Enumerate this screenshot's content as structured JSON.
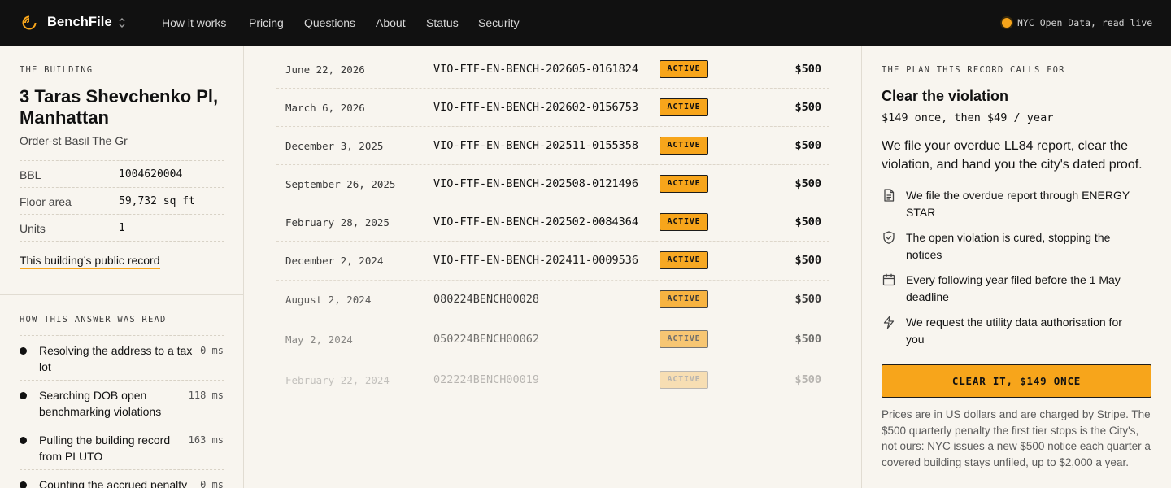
{
  "header": {
    "brand": "BenchFile",
    "nav": [
      "How it works",
      "Pricing",
      "Questions",
      "About",
      "Status",
      "Security"
    ],
    "status_text": "NYC Open Data, read live",
    "accent_color": "#f7a51b"
  },
  "building": {
    "eyebrow": "THE BUILDING",
    "title_line1": "3 Taras Shevchenko Pl,",
    "title_line2": "Manhattan",
    "subtitle": "Order-st Basil The Gr",
    "facts": [
      {
        "key": "BBL",
        "value": "1004620004"
      },
      {
        "key": "Floor area",
        "value": "59,732 sq ft"
      },
      {
        "key": "Units",
        "value": "1"
      }
    ],
    "record_link": "This building’s public record"
  },
  "reading": {
    "eyebrow": "HOW THIS ANSWER WAS READ",
    "steps": [
      {
        "label": "Resolving the address to a tax lot",
        "ms": "0 ms"
      },
      {
        "label": "Searching DOB open benchmarking violations",
        "ms": "118 ms"
      },
      {
        "label": "Pulling the building record from PLUTO",
        "ms": "163 ms"
      },
      {
        "label": "Counting the accrued penalty",
        "ms": "0 ms"
      }
    ]
  },
  "violations": [
    {
      "date": "June 22, 2026",
      "id": "VIO-FTF-EN-BENCH-202605-0161824",
      "status": "ACTIVE",
      "amount": "$500"
    },
    {
      "date": "March 6, 2026",
      "id": "VIO-FTF-EN-BENCH-202602-0156753",
      "status": "ACTIVE",
      "amount": "$500"
    },
    {
      "date": "December 3, 2025",
      "id": "VIO-FTF-EN-BENCH-202511-0155358",
      "status": "ACTIVE",
      "amount": "$500"
    },
    {
      "date": "September 26, 2025",
      "id": "VIO-FTF-EN-BENCH-202508-0121496",
      "status": "ACTIVE",
      "amount": "$500"
    },
    {
      "date": "February 28, 2025",
      "id": "VIO-FTF-EN-BENCH-202502-0084364",
      "status": "ACTIVE",
      "amount": "$500"
    },
    {
      "date": "December 2, 2024",
      "id": "VIO-FTF-EN-BENCH-202411-0009536",
      "status": "ACTIVE",
      "amount": "$500"
    },
    {
      "date": "August 2, 2024",
      "id": "080224BENCH00028",
      "status": "ACTIVE",
      "amount": "$500"
    },
    {
      "date": "May 2, 2024",
      "id": "050224BENCH00062",
      "status": "ACTIVE",
      "amount": "$500"
    },
    {
      "date": "February 22, 2024",
      "id": "022224BENCH00019",
      "status": "ACTIVE",
      "amount": "$500"
    }
  ],
  "plan": {
    "eyebrow": "THE PLAN THIS RECORD CALLS FOR",
    "title": "Clear the violation",
    "price": "$149 once, then $49 / year",
    "description": "We file your overdue LL84 report, clear the violation, and hand you the city's dated proof.",
    "features": [
      {
        "icon": "document-icon",
        "text": "We file the overdue report through ENERGY STAR"
      },
      {
        "icon": "shield-check-icon",
        "text": "The open violation is cured, stopping the notices"
      },
      {
        "icon": "calendar-icon",
        "text": "Every following year filed before the 1 May deadline"
      },
      {
        "icon": "lightning-icon",
        "text": "We request the utility data authorisation for you"
      }
    ],
    "cta": "CLEAR IT, $149 ONCE",
    "fine_print": "Prices are in US dollars and are charged by Stripe. The $500 quarterly penalty the first tier stops is the City's, not ours: NYC issues a new $500 notice each quarter a covered building stays unfiled, up to $2,000 a year."
  }
}
